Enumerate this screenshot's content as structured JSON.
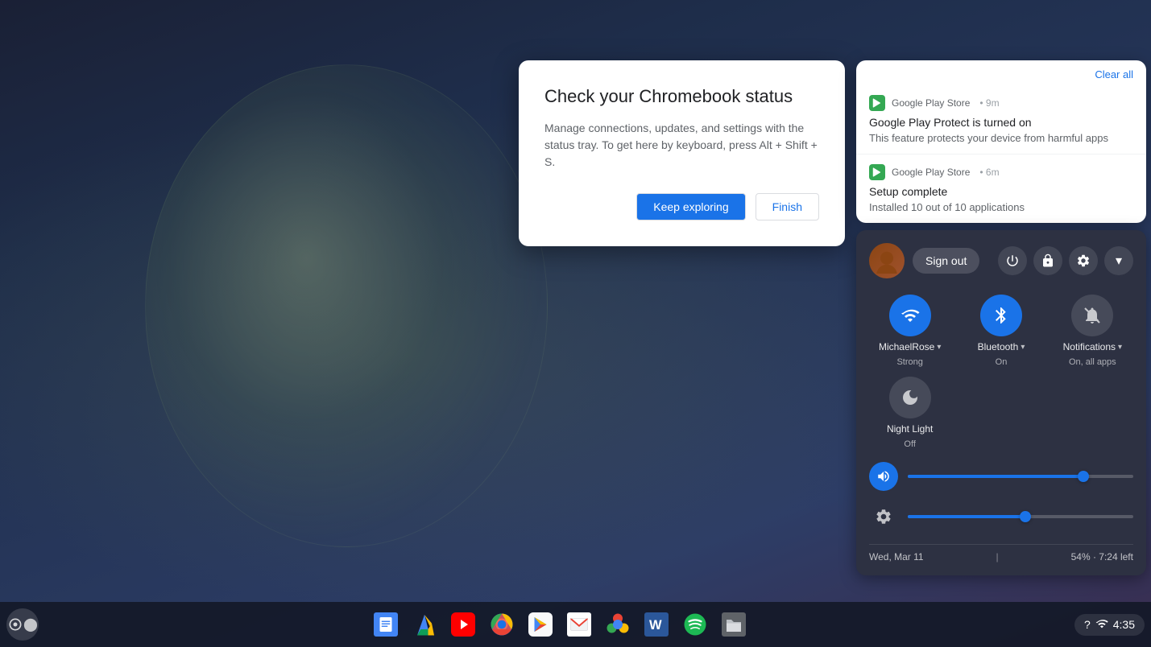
{
  "desktop": {
    "background": "chromeos-desktop"
  },
  "dialog": {
    "title": "Check your Chromebook status",
    "body": "Manage connections, updates, and settings with the status tray. To get here by keyboard, press Alt + Shift + S.",
    "keep_exploring_label": "Keep exploring",
    "finish_label": "Finish"
  },
  "notifications": {
    "clear_all_label": "Clear all",
    "items": [
      {
        "source": "Google Play Store",
        "time": "9m",
        "title": "Google Play Protect is turned on",
        "desc": "This feature protects your device from harmful apps"
      },
      {
        "source": "Google Play Store",
        "time": "6m",
        "title": "Setup complete",
        "desc": "Installed 10 out of 10 applications"
      }
    ]
  },
  "quick_settings": {
    "sign_out_label": "Sign out",
    "wifi": {
      "label": "MichaelRose",
      "status": "Strong"
    },
    "bluetooth": {
      "label": "Bluetooth",
      "status": "On"
    },
    "notifications": {
      "label": "Notifications",
      "status": "On, all apps"
    },
    "night_light": {
      "label": "Night Light",
      "status": "Off"
    },
    "volume_percent": 78,
    "brightness_percent": 52,
    "footer": {
      "date": "Wed, Mar 11",
      "battery": "54% · 7:24 left"
    }
  },
  "taskbar": {
    "apps": [
      {
        "name": "Google Docs",
        "icon": "docs"
      },
      {
        "name": "Google Drive",
        "icon": "drive"
      },
      {
        "name": "YouTube",
        "icon": "youtube"
      },
      {
        "name": "Chrome",
        "icon": "chrome"
      },
      {
        "name": "Google Play",
        "icon": "play"
      },
      {
        "name": "Gmail",
        "icon": "gmail"
      },
      {
        "name": "Google Photos",
        "icon": "photos"
      },
      {
        "name": "Microsoft Word",
        "icon": "word"
      },
      {
        "name": "Spotify",
        "icon": "spotify"
      },
      {
        "name": "Files",
        "icon": "files"
      }
    ],
    "time": "4:35",
    "help_label": "?",
    "wifi_icon": "wifi",
    "battery_icon": "battery"
  }
}
